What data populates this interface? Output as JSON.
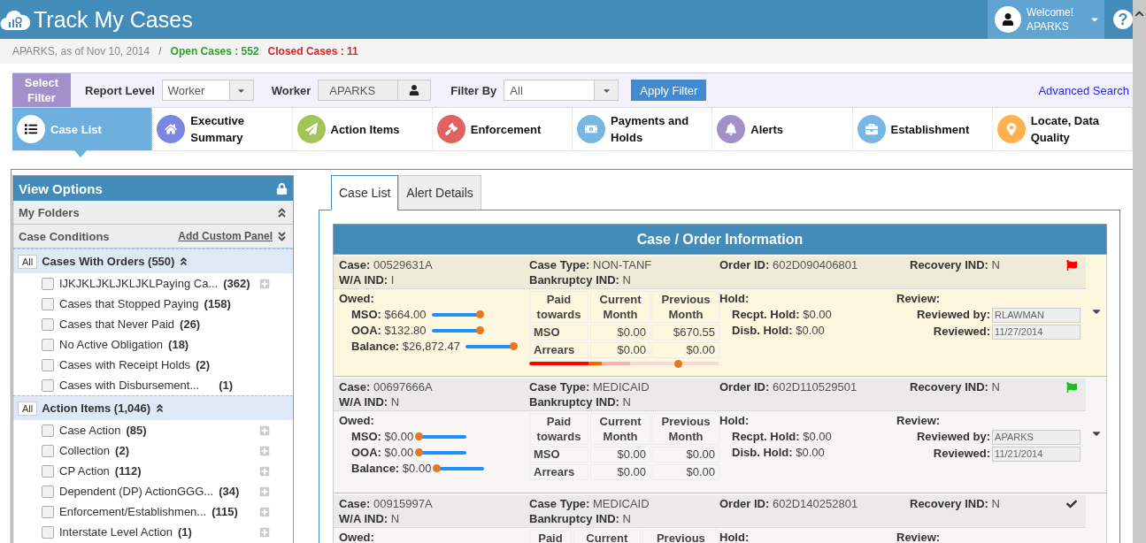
{
  "header": {
    "title": "Track My Cases",
    "welcome": "Welcome!",
    "user": "APARKS",
    "help": "?"
  },
  "summary": {
    "as_of": "APARKS, as of Nov 10, 2014",
    "separator": "/",
    "open": "Open Cases : 552",
    "closed": "Closed Cases : 11"
  },
  "filter": {
    "select_label": "Select Filter",
    "report_level_label": "Report Level",
    "report_level": "Worker",
    "worker_label": "Worker",
    "worker": "APARKS",
    "filter_by_label": "Filter By",
    "filter_by": "All",
    "apply": "Apply Filter",
    "advanced": "Advanced Search"
  },
  "nav_tabs": [
    {
      "label": "Case List",
      "color": "#ffffff",
      "selected": true
    },
    {
      "label": "Executive Summary",
      "color": "#7b86e0",
      "selected": false
    },
    {
      "label": "Action Items",
      "color": "#a4c457",
      "selected": false
    },
    {
      "label": "Enforcement",
      "color": "#e06262",
      "selected": false
    },
    {
      "label": "Payments and Holds",
      "color": "#76b8e3",
      "selected": false
    },
    {
      "label": "Alerts",
      "color": "#a390c9",
      "selected": false
    },
    {
      "label": "Establishment",
      "color": "#76b8e3",
      "selected": false
    },
    {
      "label": "Locate, Data Quality",
      "color": "#ffb24d",
      "selected": false
    }
  ],
  "view_options": {
    "title": "View Options",
    "panels": [
      {
        "label": "My Folders",
        "expanded": true
      },
      {
        "label": "Case Conditions",
        "link": "Add Custom Panel",
        "expanded": false
      }
    ],
    "groups": [
      {
        "all": "All",
        "title": "Cases With Orders (550)",
        "expanded": true,
        "items": [
          {
            "label": "IJKJKLJKLJKLJKLPaying Ca...",
            "count": "(362)",
            "checked": false,
            "expandable": true
          },
          {
            "label": "Cases that Stopped Paying",
            "count": "(158)",
            "checked": false,
            "expandable": false
          },
          {
            "label": "Cases that Never Paid",
            "count": "(26)",
            "checked": false,
            "expandable": false
          },
          {
            "label": "No Active Obligation",
            "count": "(18)",
            "checked": false,
            "expandable": false
          },
          {
            "label": "Cases with Receipt Holds",
            "count": "(2)",
            "checked": false,
            "expandable": false
          },
          {
            "label": "Cases with Disbursement...",
            "count": "(1)",
            "checked": false,
            "expandable": false
          }
        ]
      },
      {
        "all": "All",
        "title": "Action Items (1,046)",
        "expanded": true,
        "items": [
          {
            "label": "Case Action",
            "count": "(85)",
            "checked": false,
            "expandable": true
          },
          {
            "label": "Collection",
            "count": "(2)",
            "checked": false,
            "expandable": true
          },
          {
            "label": "CP Action",
            "count": "(112)",
            "checked": false,
            "expandable": true
          },
          {
            "label": "Dependent (DP) ActionGGG...",
            "count": "(34)",
            "checked": false,
            "expandable": true
          },
          {
            "label": "Enforcement/Establishmen...",
            "count": "(115)",
            "checked": false,
            "expandable": true
          },
          {
            "label": "Interstate Level Action",
            "count": "(1)",
            "checked": false,
            "expandable": true
          }
        ]
      }
    ]
  },
  "content_tabs": [
    {
      "label": "Case List",
      "selected": true
    },
    {
      "label": "Alert Details",
      "selected": false
    }
  ],
  "case_panel": {
    "title": "Case / Order Information",
    "cases": [
      {
        "selected": true,
        "marker": {
          "kind": "flag",
          "color": "#ff0000"
        },
        "fields": [
          {
            "label": "Case:",
            "value": "00529631A"
          },
          {
            "label": "Case Type:",
            "value": "NON-TANF"
          },
          {
            "label": "Order ID:",
            "value": "602D090406801"
          },
          {
            "label": "Recovery IND:",
            "value": "N"
          },
          {
            "label": "W/A IND:",
            "value": "I"
          },
          {
            "label": "Bankruptcy IND:",
            "value": "N"
          }
        ],
        "owed_label": "Owed:",
        "owed": [
          {
            "label": "MSO:",
            "value": "$664.00",
            "level": 1
          },
          {
            "label": "OOA:",
            "value": "$132.80",
            "level": 1
          },
          {
            "label": "Balance:",
            "value": "$26,872.47",
            "level": 1
          }
        ],
        "paid_headers": [
          "Paid towards",
          "Current Month",
          "Previous Month"
        ],
        "paid_rows": [
          [
            "MSO",
            "$0.00",
            "$670.55"
          ],
          [
            "Arrears",
            "$0.00",
            "$0.00"
          ]
        ],
        "arrears_meter": {
          "level": 0.78
        },
        "hold_label": "Hold:",
        "holds": [
          {
            "label": "Recpt. Hold:",
            "value": "$0.00"
          },
          {
            "label": "Disb. Hold:",
            "value": "$0.00"
          }
        ],
        "review_label": "Review:",
        "reviews": [
          {
            "label": "Reviewed by:",
            "value": "RLAWMAN"
          },
          {
            "label": "Reviewed:",
            "value": "11/27/2014"
          }
        ]
      },
      {
        "selected": false,
        "marker": {
          "kind": "flag",
          "color": "#22bb22"
        },
        "fields": [
          {
            "label": "Case:",
            "value": "00697666A"
          },
          {
            "label": "Case Type:",
            "value": "MEDICAID"
          },
          {
            "label": "Order ID:",
            "value": "602D110529501"
          },
          {
            "label": "Recovery IND:",
            "value": "N"
          },
          {
            "label": "W/A IND:",
            "value": "N"
          },
          {
            "label": "Bankruptcy IND:",
            "value": "N"
          }
        ],
        "owed_label": "Owed:",
        "owed": [
          {
            "label": "MSO:",
            "value": "$0.00",
            "level": 0
          },
          {
            "label": "OOA:",
            "value": "$0.00",
            "level": 0
          },
          {
            "label": "Balance:",
            "value": "$0.00",
            "level": 0
          }
        ],
        "paid_headers": [
          "Paid towards",
          "Current Month",
          "Previous Month"
        ],
        "paid_rows": [
          [
            "MSO",
            "$0.00",
            "$0.00"
          ],
          [
            "Arrears",
            "$0.00",
            "$0.00"
          ]
        ],
        "hold_label": "Hold:",
        "holds": [
          {
            "label": "Recpt. Hold:",
            "value": "$0.00"
          },
          {
            "label": "Disb. Hold:",
            "value": "$0.00"
          }
        ],
        "review_label": "Review:",
        "reviews": [
          {
            "label": "Reviewed by:",
            "value": "APARKS"
          },
          {
            "label": "Reviewed:",
            "value": "11/21/2014"
          }
        ]
      },
      {
        "selected": false,
        "marker": {
          "kind": "check"
        },
        "fields": [
          {
            "label": "Case:",
            "value": "00915997A"
          },
          {
            "label": "Case Type:",
            "value": "MEDICAID"
          },
          {
            "label": "Order ID:",
            "value": "602D140252801"
          },
          {
            "label": "Recovery IND:",
            "value": "N"
          },
          {
            "label": "W/A IND:",
            "value": "N"
          },
          {
            "label": "Bankruptcy IND:",
            "value": "N"
          }
        ],
        "owed_label": "Owed:",
        "paid_headers": [
          "Paid",
          "Current",
          "Previous"
        ],
        "hold_label": "Hold:",
        "review_label": "Review:"
      }
    ]
  }
}
